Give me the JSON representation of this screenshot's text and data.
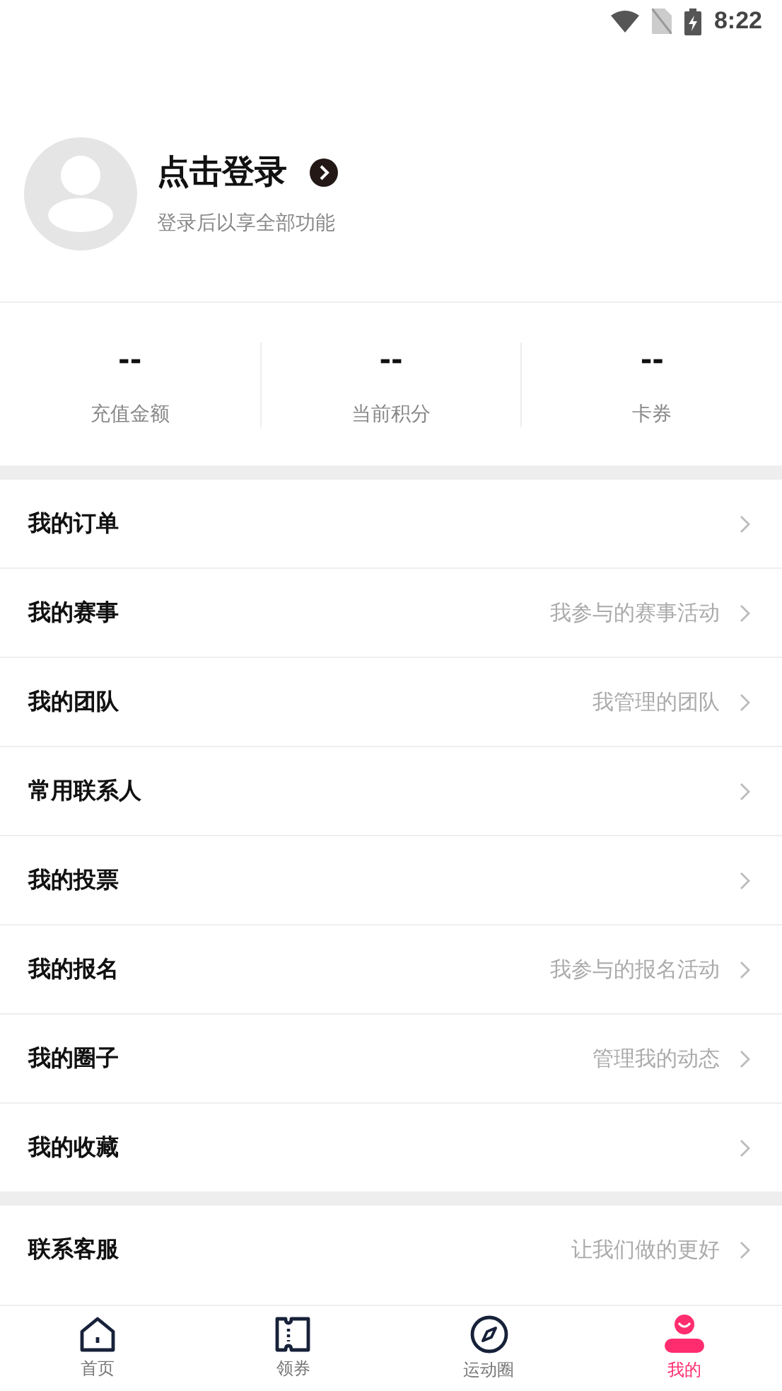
{
  "status_bar": {
    "time": "8:22"
  },
  "profile": {
    "login_label": "点击登录",
    "subtitle": "登录后以享全部功能"
  },
  "stats": [
    {
      "value": "--",
      "label": "充值金额"
    },
    {
      "value": "--",
      "label": "当前积分"
    },
    {
      "value": "--",
      "label": "卡券"
    }
  ],
  "menu_groups": [
    [
      {
        "label": "我的订单"
      },
      {
        "label": "我的赛事",
        "hint": "我参与的赛事活动"
      },
      {
        "label": "我的团队",
        "hint": "我管理的团队"
      },
      {
        "label": "常用联系人"
      },
      {
        "label": "我的投票"
      },
      {
        "label": "我的报名",
        "hint": "我参与的报名活动"
      },
      {
        "label": "我的圈子",
        "hint": "管理我的动态"
      },
      {
        "label": "我的收藏"
      }
    ],
    [
      {
        "label": "联系客服",
        "hint": "让我们做的更好"
      }
    ]
  ],
  "tab_bar": [
    {
      "kind": "home",
      "label": "首页",
      "selected": false
    },
    {
      "kind": "ticket",
      "label": "领券",
      "selected": false
    },
    {
      "kind": "compass",
      "label": "运动圈",
      "selected": false
    },
    {
      "kind": "person",
      "label": "我的",
      "selected": true
    }
  ]
}
